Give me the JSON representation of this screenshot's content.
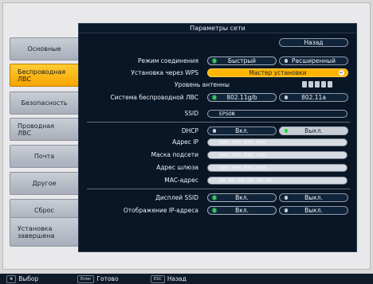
{
  "panel": {
    "title": "Параметры сети",
    "back_label": "Назад"
  },
  "sidebar": {
    "items": [
      {
        "label": "Основные"
      },
      {
        "label": "Беспроводная ЛВС"
      },
      {
        "label": "Безопасность"
      },
      {
        "label": "Проводная ЛВС"
      },
      {
        "label": "Почта"
      },
      {
        "label": "Другое"
      },
      {
        "label": "Сброс"
      },
      {
        "label": "Установка завершена"
      }
    ],
    "active_index": 1
  },
  "settings": {
    "connection_mode": {
      "label": "Режим соединения",
      "options": [
        "Быстрый",
        "Расширенный"
      ],
      "selected": "Быстрый"
    },
    "wps": {
      "label": "Установка через WPS",
      "button": "Мастер установки"
    },
    "antenna": {
      "label": "Уровень антенны"
    },
    "wireless_system": {
      "label": "Система беспроводной ЛВС",
      "options": [
        "802.11g/b",
        "802.11a"
      ],
      "selected": "802.11g/b"
    },
    "ssid": {
      "label": "SSID",
      "value": "EPSON"
    },
    "dhcp": {
      "label": "DHCP",
      "options": [
        "Вкл.",
        "Выкл."
      ],
      "selected": "Выкл."
    },
    "ip": {
      "label": "Адрес IP",
      "value": "000.000.000.000"
    },
    "subnet": {
      "label": "Маска подсети",
      "value": "000.000.000.000"
    },
    "gateway": {
      "label": "Адрес шлюза",
      "value": "000.000.000.000"
    },
    "mac": {
      "label": "MAC-адрес",
      "value": "00.00.00.00.00.00"
    },
    "ssid_display": {
      "label": "Дисплей SSID",
      "options": [
        "Вкл.",
        "Выкл."
      ],
      "selected": "Вкл."
    },
    "ip_display": {
      "label": "Отображение IP-адреса",
      "options": [
        "Вкл.",
        "Выкл."
      ],
      "selected": "Вкл."
    }
  },
  "footer": {
    "select": {
      "label": "Выбор"
    },
    "enter": {
      "key": "Enter",
      "label": "Готово"
    },
    "esc": {
      "key": "ESC",
      "label": "Назад"
    }
  },
  "colors": {
    "accent": "#ffb400",
    "panel_bg": "#081626",
    "on_indicator": "#2bd24d"
  }
}
